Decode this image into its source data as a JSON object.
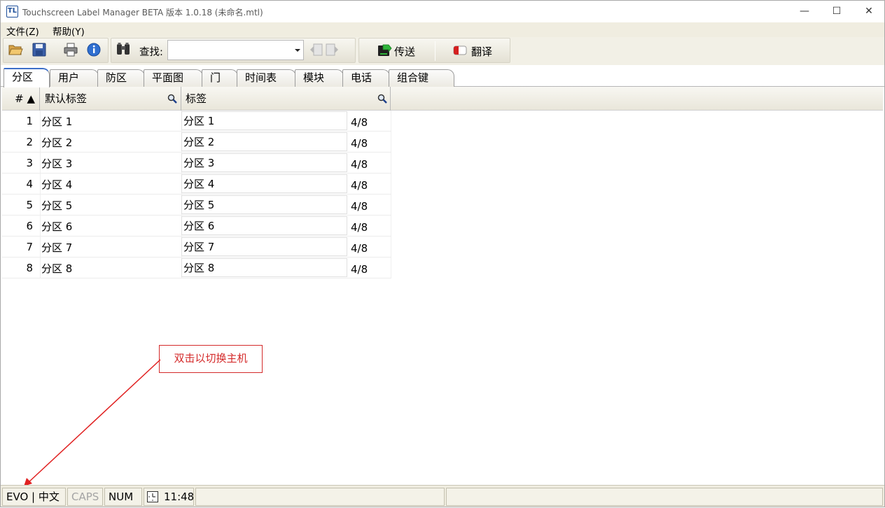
{
  "window": {
    "title": "Touchscreen Label Manager BETA 版本 1.0.18 (未命名.mtl)",
    "app_icon_text": "TL",
    "controls": {
      "minimize": "—",
      "maximize": "☐",
      "close": "✕"
    }
  },
  "menu": {
    "file": "文件(Z)",
    "help": "帮助(Y)"
  },
  "toolbar": {
    "find_label": "查找:",
    "search_value": "",
    "search_placeholder": "",
    "send_label": "传送",
    "translate_label": "翻译"
  },
  "tabs": [
    "分区",
    "用户",
    "防区",
    "平面图",
    "门",
    "时间表",
    "模块",
    "电话",
    "组合键"
  ],
  "active_tab": 0,
  "grid": {
    "headers": {
      "num": "# ▲",
      "default_label": "默认标签",
      "label": "标签"
    },
    "rows": [
      {
        "num": "1",
        "default_label": "分区 1",
        "label": "分区 1",
        "count": "4/8"
      },
      {
        "num": "2",
        "default_label": "分区 2",
        "label": "分区 2",
        "count": "4/8"
      },
      {
        "num": "3",
        "default_label": "分区 3",
        "label": "分区 3",
        "count": "4/8"
      },
      {
        "num": "4",
        "default_label": "分区 4",
        "label": "分区 4",
        "count": "4/8"
      },
      {
        "num": "5",
        "default_label": "分区 5",
        "label": "分区 5",
        "count": "4/8"
      },
      {
        "num": "6",
        "default_label": "分区 6",
        "label": "分区 6",
        "count": "4/8"
      },
      {
        "num": "7",
        "default_label": "分区 7",
        "label": "分区 7",
        "count": "4/8"
      },
      {
        "num": "8",
        "default_label": "分区 8",
        "label": "分区 8",
        "count": "4/8"
      }
    ]
  },
  "annotation": {
    "text": "双击以切换主机",
    "color": "#d42a2a"
  },
  "status": {
    "host": "EVO | 中文",
    "caps": "CAPS",
    "num": "NUM",
    "time": "11:48"
  },
  "colors": {
    "accent": "#3d6fc8",
    "toolbar_bg": "#f2f0e6",
    "annotation": "#d42a2a"
  }
}
